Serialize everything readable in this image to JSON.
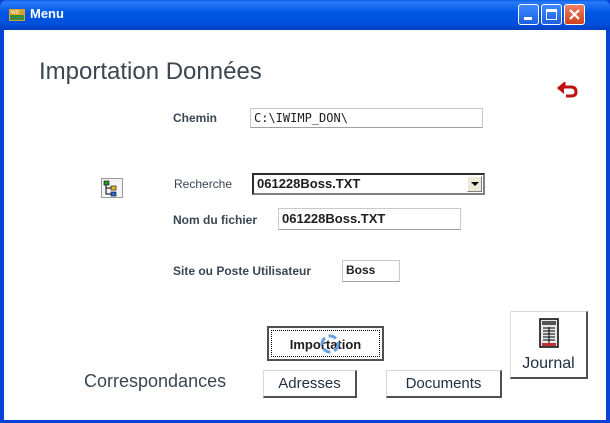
{
  "window": {
    "title": "Menu"
  },
  "form": {
    "heading": "Importation Données",
    "chemin": {
      "label": "Chemin",
      "value": "C:\\IWIMP_DON\\"
    },
    "recherche": {
      "label": "Recherche",
      "selected": "061228Boss.TXT"
    },
    "nom_fichier": {
      "label": "Nom du fichier",
      "value": "061228Boss.TXT"
    },
    "site": {
      "label": "Site ou Poste Utilisateur",
      "value": "Boss"
    }
  },
  "buttons": {
    "importation": "Importation",
    "journal": "Journal",
    "adresses": "Adresses",
    "documents": "Documents"
  },
  "correspondances_label": "Correspondances",
  "icons": {
    "app": "window-app-icon",
    "back": "undo-arrow-icon",
    "tree": "tree-browse-icon",
    "journal": "journal-book-icon",
    "busy": "busy-cursor-icon"
  },
  "colors": {
    "titlebar": "#0058e6",
    "close": "#d0401c",
    "text": "#3a4652"
  }
}
